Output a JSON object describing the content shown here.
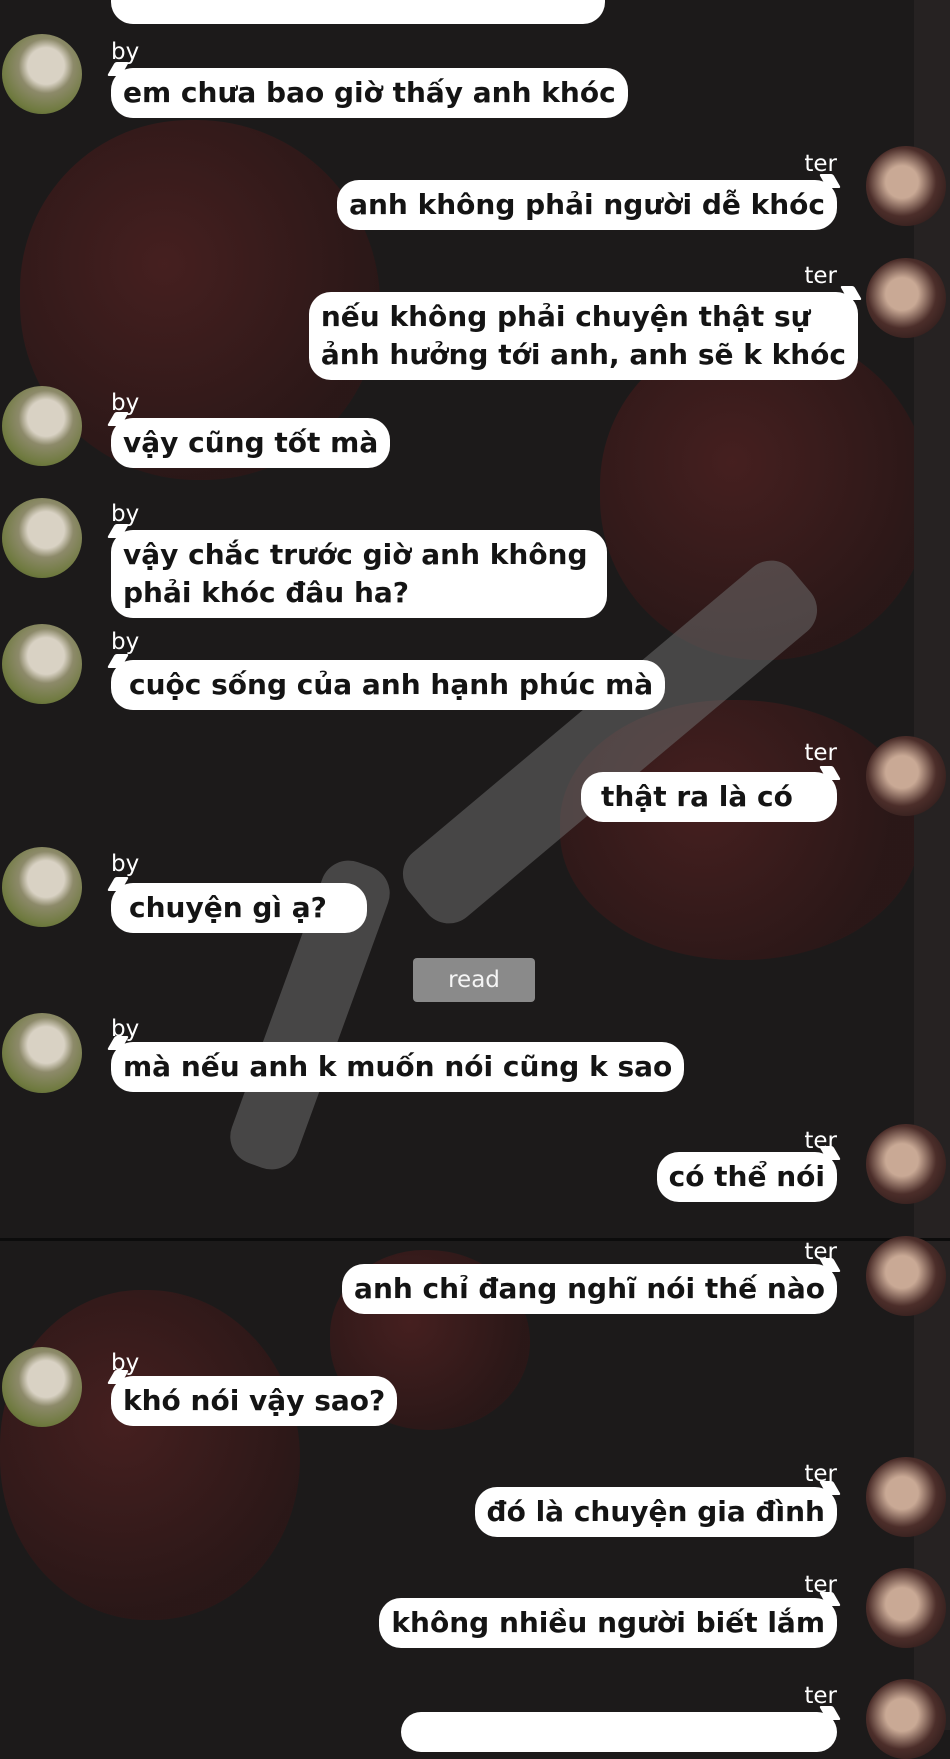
{
  "chat": {
    "participants": {
      "left_name": "by",
      "right_name": "ter"
    },
    "messages": [
      {
        "side": "left",
        "name": "by",
        "text": "em chưa bao giờ thấy anh khóc"
      },
      {
        "side": "right",
        "name": "ter",
        "text": "anh không phải người dễ khóc"
      },
      {
        "side": "right",
        "name": "ter",
        "text": "nếu không phải chuyện thật sự\nảnh hưởng tới anh, anh sẽ k khóc"
      },
      {
        "side": "left",
        "name": "by",
        "text": "vậy cũng tốt mà"
      },
      {
        "side": "left",
        "name": "by",
        "text": "vậy chắc trước giờ anh không\nphải khóc đâu ha?"
      },
      {
        "side": "left",
        "name": "by",
        "text": "cuộc sống của anh hạnh phúc mà"
      },
      {
        "side": "right",
        "name": "ter",
        "text": "thật ra là có"
      },
      {
        "side": "left",
        "name": "by",
        "text": "chuyện gì ạ?"
      },
      {
        "side": "left",
        "name": "by",
        "text": "mà nếu anh k muốn nói cũng k sao"
      },
      {
        "side": "right",
        "name": "ter",
        "text": "có thể nói"
      },
      {
        "side": "right",
        "name": "ter",
        "text": "anh chỉ đang nghĩ nói thế nào"
      },
      {
        "side": "left",
        "name": "by",
        "text": "khó nói vậy sao?"
      },
      {
        "side": "right",
        "name": "ter",
        "text": "đó là chuyện gia đình"
      },
      {
        "side": "right",
        "name": "ter",
        "text": "không nhiều người biết lắm"
      },
      {
        "side": "right",
        "name": "ter",
        "text": ""
      }
    ],
    "read_receipt": "read"
  }
}
